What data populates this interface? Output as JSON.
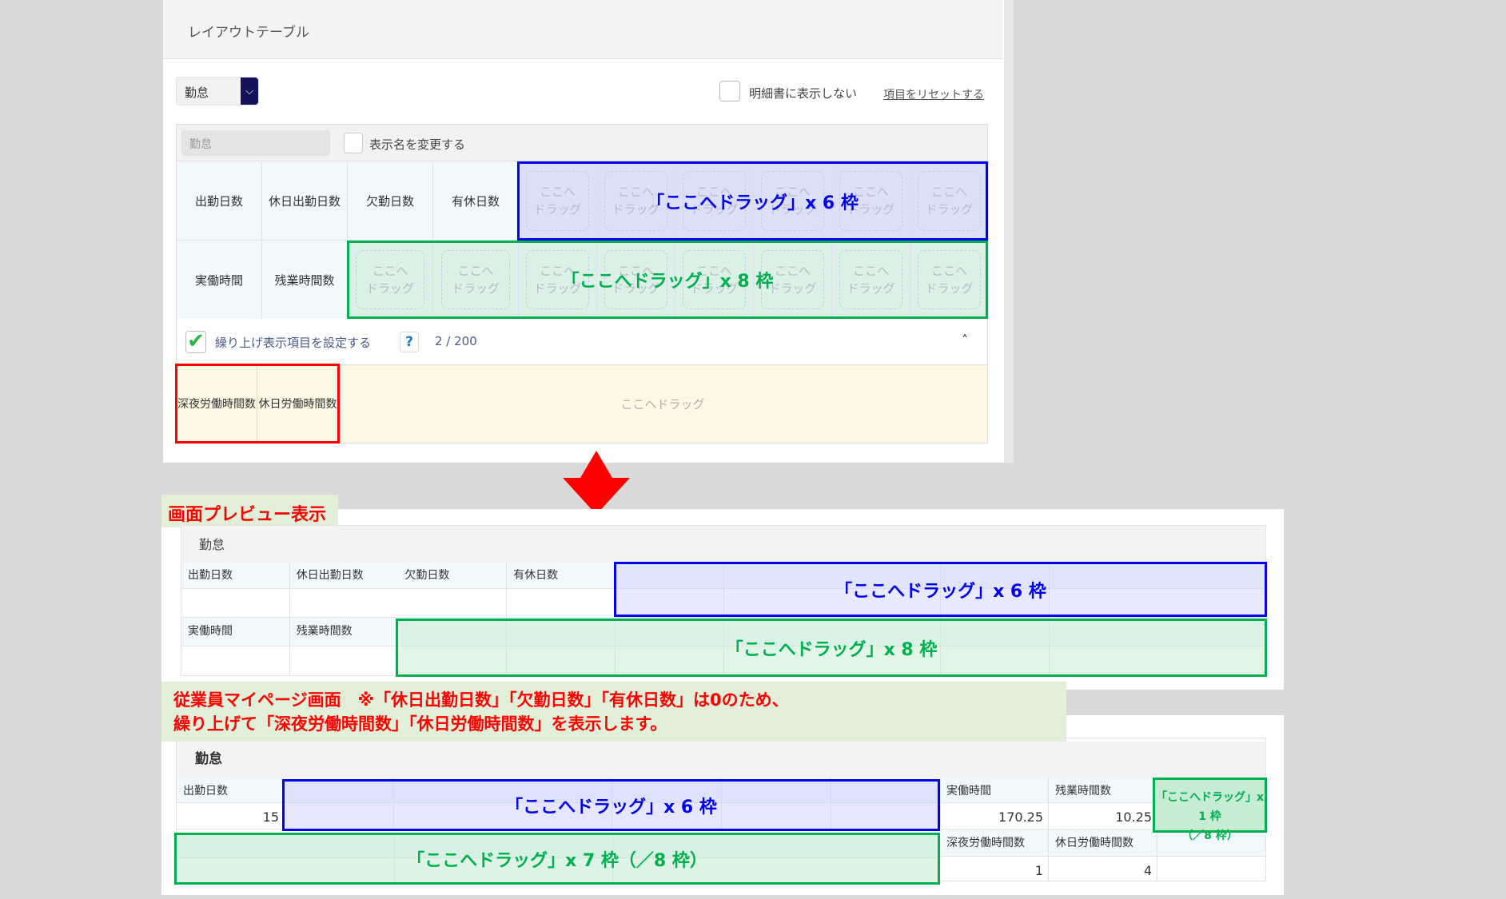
{
  "editor": {
    "title": "レイアウトテーブル",
    "category_select": "勤怠",
    "hide_checkbox_label": "明細書に表示しない",
    "reset_link": "項目をリセットする",
    "name_input_value": "勤怠",
    "rename_checkbox_label": "表示名を変更する",
    "row1_items": [
      "出勤日数",
      "休日出勤日数",
      "欠勤日数",
      "有休日数"
    ],
    "row2_items": [
      "実働時間",
      "残業時間数"
    ],
    "drag_line1": "ここへ",
    "drag_line2": "ドラッグ",
    "row1_annotation": "「ここへドラッグ」x 6 枠",
    "row2_annotation": "「ここへドラッグ」x 8 枠",
    "carry_up_label": "繰り上げ表示項目を設定する",
    "help": "?",
    "carry_up_count": "2 / 200",
    "carry_up_items": [
      "深夜労働時間数",
      "休日労働時間数"
    ],
    "carry_up_drop": "ここへドラッグ"
  },
  "preview": {
    "label": "画面プレビュー表示",
    "section": "勤怠",
    "row1_items": [
      "出勤日数",
      "休日出勤日数",
      "欠勤日数",
      "有休日数"
    ],
    "row2_items": [
      "実働時間",
      "残業時間数"
    ],
    "row1_annotation": "「ここへドラッグ」x 6 枠",
    "row2_annotation": "「ここへドラッグ」x 8 枠"
  },
  "note": {
    "line1": "従業員マイページ画面　※「休日出勤日数」「欠勤日数」「有休日数」は0のため、",
    "line2": "繰り上げて「深夜労働時間数」「休日労働時間数」を表示します。"
  },
  "mypage": {
    "section": "勤怠",
    "attendance_label": "出勤日数",
    "attendance_value": "15",
    "work_label": "実働時間",
    "work_value": "170.25",
    "overtime_label": "残業時間数",
    "overtime_value": "10.25",
    "night_label": "深夜労働時間数",
    "night_value": "1",
    "holiday_label": "休日労働時間数",
    "holiday_value": "4",
    "blue_annotation": "「ここへドラッグ」x 6 枠",
    "green_annotation": "「ここへドラッグ」x 7 枠（／8 枠）",
    "small_annotation_1": "「ここへドラッグ」x 1 枠",
    "small_annotation_2": "（／8 枠）"
  },
  "colors": {
    "blue": "#0000ee",
    "green": "#00b050",
    "red": "#ff0000"
  }
}
